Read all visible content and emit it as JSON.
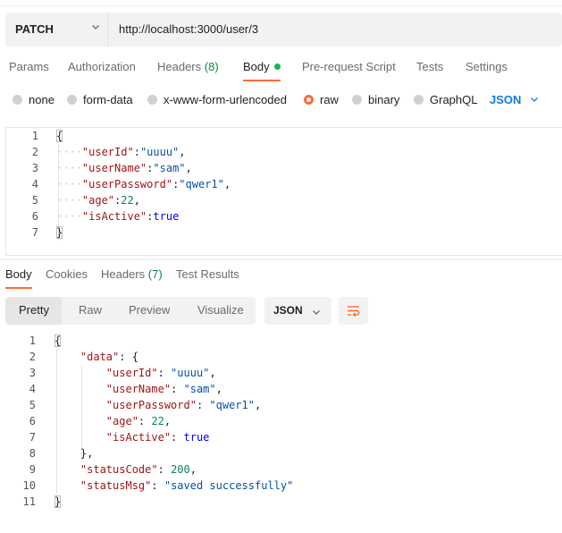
{
  "request": {
    "method": "PATCH",
    "url": "http://localhost:3000/user/3"
  },
  "request_tabs": [
    {
      "label": "Params"
    },
    {
      "label": "Authorization"
    },
    {
      "label": "Headers",
      "count": "(8)"
    },
    {
      "label": "Body"
    },
    {
      "label": "Pre-request Script"
    },
    {
      "label": "Tests"
    },
    {
      "label": "Settings"
    }
  ],
  "body_types": [
    "none",
    "form-data",
    "x-www-form-urlencoded",
    "raw",
    "binary",
    "GraphQL"
  ],
  "body_format": "JSON",
  "request_body_lines": [
    [
      {
        "t": "{",
        "c": "brace"
      }
    ],
    [
      {
        "t": "····",
        "c": "ws"
      },
      {
        "t": "\"userId\"",
        "c": "key"
      },
      {
        "t": ":",
        "c": "punc"
      },
      {
        "t": "\"uuuu\"",
        "c": "str"
      },
      {
        "t": ",",
        "c": "punc"
      }
    ],
    [
      {
        "t": "····",
        "c": "ws"
      },
      {
        "t": "\"userName\"",
        "c": "key"
      },
      {
        "t": ":",
        "c": "punc"
      },
      {
        "t": "\"sam\"",
        "c": "str"
      },
      {
        "t": ",",
        "c": "punc"
      }
    ],
    [
      {
        "t": "····",
        "c": "ws"
      },
      {
        "t": "\"userPassword\"",
        "c": "key"
      },
      {
        "t": ":",
        "c": "punc"
      },
      {
        "t": "\"qwer1\"",
        "c": "str"
      },
      {
        "t": ",",
        "c": "punc"
      }
    ],
    [
      {
        "t": "····",
        "c": "ws"
      },
      {
        "t": "\"age\"",
        "c": "key"
      },
      {
        "t": ":",
        "c": "punc"
      },
      {
        "t": "22",
        "c": "num"
      },
      {
        "t": ",",
        "c": "punc"
      }
    ],
    [
      {
        "t": "····",
        "c": "ws"
      },
      {
        "t": "\"isActive\"",
        "c": "key"
      },
      {
        "t": ":",
        "c": "punc"
      },
      {
        "t": "true",
        "c": "kw"
      }
    ],
    [
      {
        "t": "}",
        "c": "brace"
      }
    ]
  ],
  "response_tabs": [
    {
      "label": "Body"
    },
    {
      "label": "Cookies"
    },
    {
      "label": "Headers",
      "count": "(7)"
    },
    {
      "label": "Test Results"
    }
  ],
  "view_modes": [
    "Pretty",
    "Raw",
    "Preview",
    "Visualize"
  ],
  "response_format": "JSON",
  "response_body_lines": [
    [
      {
        "t": "{",
        "c": "brace"
      }
    ],
    [
      {
        "t": "    ",
        "c": "sp"
      },
      {
        "t": "\"data\"",
        "c": "key"
      },
      {
        "t": ": {",
        "c": "punc"
      }
    ],
    [
      {
        "t": "        ",
        "c": "sp"
      },
      {
        "t": "\"userId\"",
        "c": "key"
      },
      {
        "t": ": ",
        "c": "punc"
      },
      {
        "t": "\"uuuu\"",
        "c": "str"
      },
      {
        "t": ",",
        "c": "punc"
      }
    ],
    [
      {
        "t": "        ",
        "c": "sp"
      },
      {
        "t": "\"userName\"",
        "c": "key"
      },
      {
        "t": ": ",
        "c": "punc"
      },
      {
        "t": "\"sam\"",
        "c": "str"
      },
      {
        "t": ",",
        "c": "punc"
      }
    ],
    [
      {
        "t": "        ",
        "c": "sp"
      },
      {
        "t": "\"userPassword\"",
        "c": "key"
      },
      {
        "t": ": ",
        "c": "punc"
      },
      {
        "t": "\"qwer1\"",
        "c": "str"
      },
      {
        "t": ",",
        "c": "punc"
      }
    ],
    [
      {
        "t": "        ",
        "c": "sp"
      },
      {
        "t": "\"age\"",
        "c": "key"
      },
      {
        "t": ": ",
        "c": "punc"
      },
      {
        "t": "22",
        "c": "num"
      },
      {
        "t": ",",
        "c": "punc"
      }
    ],
    [
      {
        "t": "        ",
        "c": "sp"
      },
      {
        "t": "\"isActive\"",
        "c": "key"
      },
      {
        "t": ": ",
        "c": "punc"
      },
      {
        "t": "true",
        "c": "kw"
      }
    ],
    [
      {
        "t": "    ",
        "c": "sp"
      },
      {
        "t": "},",
        "c": "punc"
      }
    ],
    [
      {
        "t": "    ",
        "c": "sp"
      },
      {
        "t": "\"statusCode\"",
        "c": "key"
      },
      {
        "t": ": ",
        "c": "punc"
      },
      {
        "t": "200",
        "c": "num"
      },
      {
        "t": ",",
        "c": "punc"
      }
    ],
    [
      {
        "t": "    ",
        "c": "sp"
      },
      {
        "t": "\"statusMsg\"",
        "c": "key"
      },
      {
        "t": ": ",
        "c": "punc"
      },
      {
        "t": "\"saved successfully\"",
        "c": "str"
      }
    ],
    [
      {
        "t": "}",
        "c": "brace"
      }
    ]
  ],
  "colors": {
    "accent": "#ff6c37",
    "link_blue": "#097bed",
    "count_green": "#0c8a3e",
    "active_dot": "#0cbb52"
  },
  "icons": {
    "method_dropdown": "chevron-down-icon",
    "format_dropdown": "chevron-down-icon",
    "wrap": "wrap-lines-icon"
  }
}
